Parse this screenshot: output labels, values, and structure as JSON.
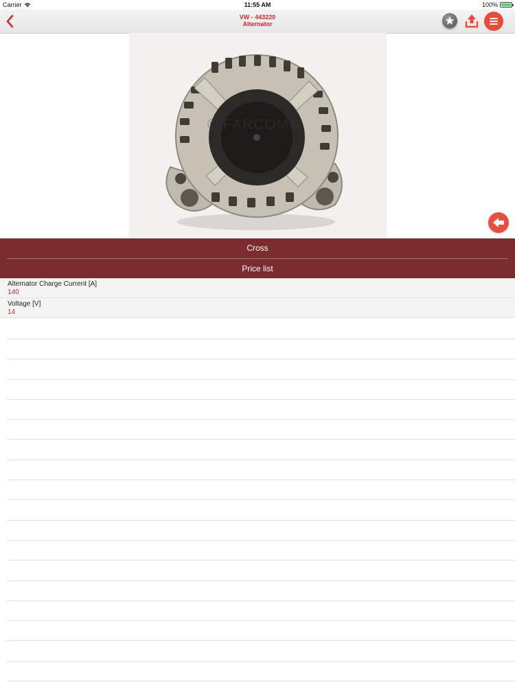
{
  "status_bar": {
    "carrier": "Carrier",
    "time": "11:55 AM",
    "battery": "100%",
    "battery_level": 1.0
  },
  "nav": {
    "title": "VW - 443220",
    "subtitle": "Alternator",
    "back_icon": "chevron-left-icon",
    "favorite_icon": "star-icon",
    "share_icon": "upload-icon",
    "menu_icon": "menu-icon",
    "accent": "#d52a2a"
  },
  "product": {
    "watermark": "© FARCOM",
    "prev_icon": "arrow-left-icon"
  },
  "actions": [
    {
      "label": "Cross"
    },
    {
      "label": "Price list"
    }
  ],
  "properties": [
    {
      "name": "Alternator Charge Current [A]",
      "value": "140"
    },
    {
      "name": "Voltage [V]",
      "value": "14"
    }
  ],
  "colors": {
    "action_bg": "#7a2c2e",
    "value_text": "#b33133",
    "button": "#ea4a3a"
  }
}
